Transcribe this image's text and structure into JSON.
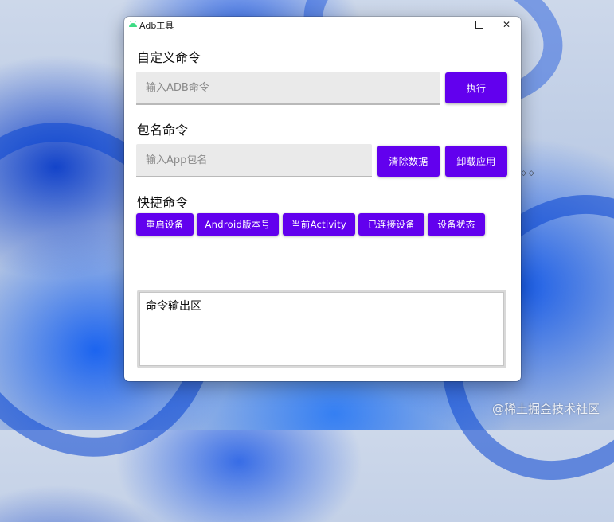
{
  "window": {
    "title": "Adb工具",
    "controls": {
      "minimize": "minimize-icon",
      "maximize": "maximize-icon",
      "close": "✕"
    }
  },
  "custom_command": {
    "heading": "自定义命令",
    "input_placeholder": "输入ADB命令",
    "execute_label": "执行"
  },
  "package_command": {
    "heading": "包名命令",
    "input_placeholder": "输入App包名",
    "clear_data_label": "清除数据",
    "uninstall_label": "卸载应用"
  },
  "quick_commands": {
    "heading": "快捷命令",
    "buttons": [
      {
        "label": "重启设备"
      },
      {
        "label": "Android版本号"
      },
      {
        "label": "当前Activity"
      },
      {
        "label": "已连接设备"
      },
      {
        "label": "设备状态"
      }
    ]
  },
  "output": {
    "text": "命令输出区"
  },
  "desktop": {
    "watermark": "@稀土掘金技术社区",
    "cursor": "◇ ◇"
  },
  "colors": {
    "accent": "#6200ee",
    "window_bg": "#ffffff",
    "input_bg": "#eaeaea"
  }
}
